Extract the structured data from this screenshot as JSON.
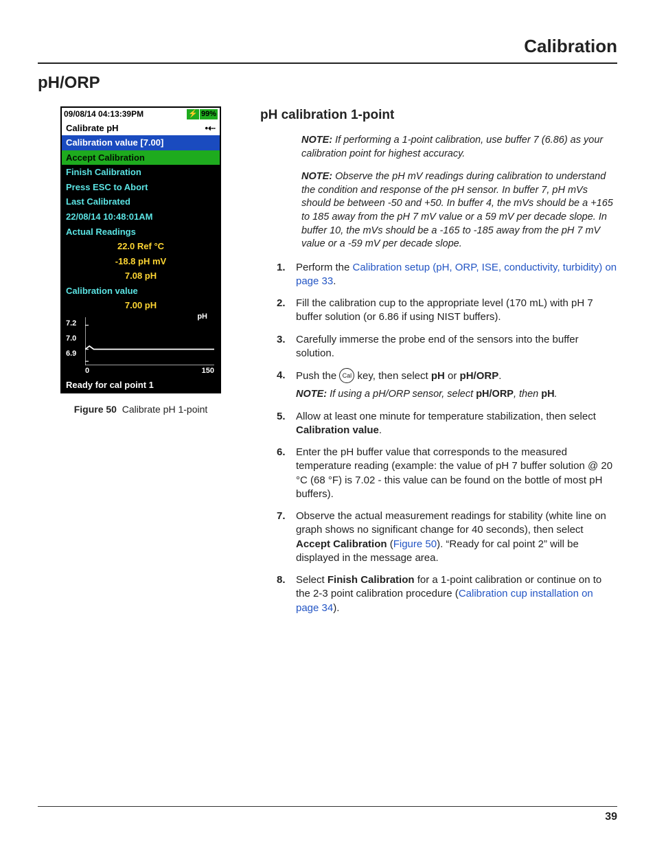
{
  "running_head": "Calibration",
  "section_title": "pH/ORP",
  "figure": {
    "caption_label": "Figure 50",
    "caption_text": "Calibrate pH 1-point"
  },
  "device": {
    "status_time": "09/08/14 04:13:39PM",
    "battery_pct": "99%",
    "title": "Calibrate pH",
    "usb_glyph": "•⇠",
    "rows": {
      "cal_value_header": "Calibration value [7.00]",
      "accept": "Accept Calibration",
      "finish": "Finish Calibration",
      "abort": "Press ESC to Abort",
      "last_cal_label": "Last Calibrated",
      "last_cal_time": "22/08/14 10:48:01AM",
      "actual_readings": "Actual Readings",
      "ref_temp": "22.0 Ref °C",
      "ph_mv": "-18.8 pH mV",
      "ph": "7.08 pH",
      "cal_value_label": "Calibration value",
      "cal_value": "7.00 pH"
    },
    "plot_label": "pH",
    "footer": "Ready for cal point 1"
  },
  "chart_data": {
    "type": "line",
    "title": "pH",
    "xlabel": "",
    "ylabel": "",
    "xlim": [
      0,
      150
    ],
    "ylim": [
      6.9,
      7.2
    ],
    "xticks": [
      "0",
      "150"
    ],
    "yticks": [
      "7.2",
      "7.0",
      "6.9"
    ],
    "series": [
      {
        "name": "pH",
        "x": [
          0,
          5,
          10,
          150
        ],
        "y": [
          7.0,
          7.02,
          7.0,
          7.0
        ]
      }
    ]
  },
  "subhead": "pH calibration 1-point",
  "notes": {
    "n1": "If performing a 1-point calibration, use buffer 7 (6.86) as your calibration point for highest accuracy.",
    "n2": "Observe the pH mV readings during calibration to understand the condition  and response of the pH sensor. In buffer 7, pH mVs should be between -50 and +50. In buffer 4, the mVs should be a +165 to 185 away from the pH 7 mV value or a 59 mV per decade slope. In buffer 10, the mVs should be a -165 to -185 away from the pH 7 mV value or a -59 mV per decade slope."
  },
  "steps": {
    "s1a": "Perform the ",
    "s1link": "Calibration setup (pH, ORP, ISE, conductivity, turbidity) on page 33",
    "s1b": ".",
    "s2": "Fill the calibration cup to the appropriate level (170 mL) with pH 7 buffer solution (or 6.86 if using NIST buffers).",
    "s3": "Carefully immerse the probe end of the sensors into the buffer solution.",
    "s4a": "Push the ",
    "s4key": "Cal",
    "s4b": " key, then select ",
    "s4c": " or ",
    "s4d": ".",
    "s4bold1": "pH",
    "s4bold2": "pH/ORP",
    "s4note_a": "If using a pH/ORP sensor, select ",
    "s4note_b": ", then ",
    "s4note_bold1": "pH/ORP",
    "s4note_bold2": "pH",
    "s4note_c": ".",
    "s5a": "Allow at least one  minute for temperature stabilization, then select ",
    "s5bold": "Calibration value",
    "s5b": ".",
    "s6": "Enter the pH buffer value that corresponds to the measured temperature reading (example: the value of pH 7 buffer solution @ 20 °C (68 °F) is 7.02 - this value can be found on the bottle of most pH buffers).",
    "s7a": "Observe the actual measurement readings for stability (white line on graph shows no significant change for 40 seconds), then select ",
    "s7bold": "Accept Calibration",
    "s7b": " (",
    "s7link": "Figure 50",
    "s7c": "). “Ready for cal point 2” will be displayed in the message area.",
    "s8a": "Select ",
    "s8bold": "Finish Calibration",
    "s8b": " for a 1-point calibration or continue on to the 2-3 point calibration procedure (",
    "s8link": "Calibration cup installation on page 34",
    "s8c": ")."
  },
  "note_label": "NOTE:",
  "page_number": "39"
}
